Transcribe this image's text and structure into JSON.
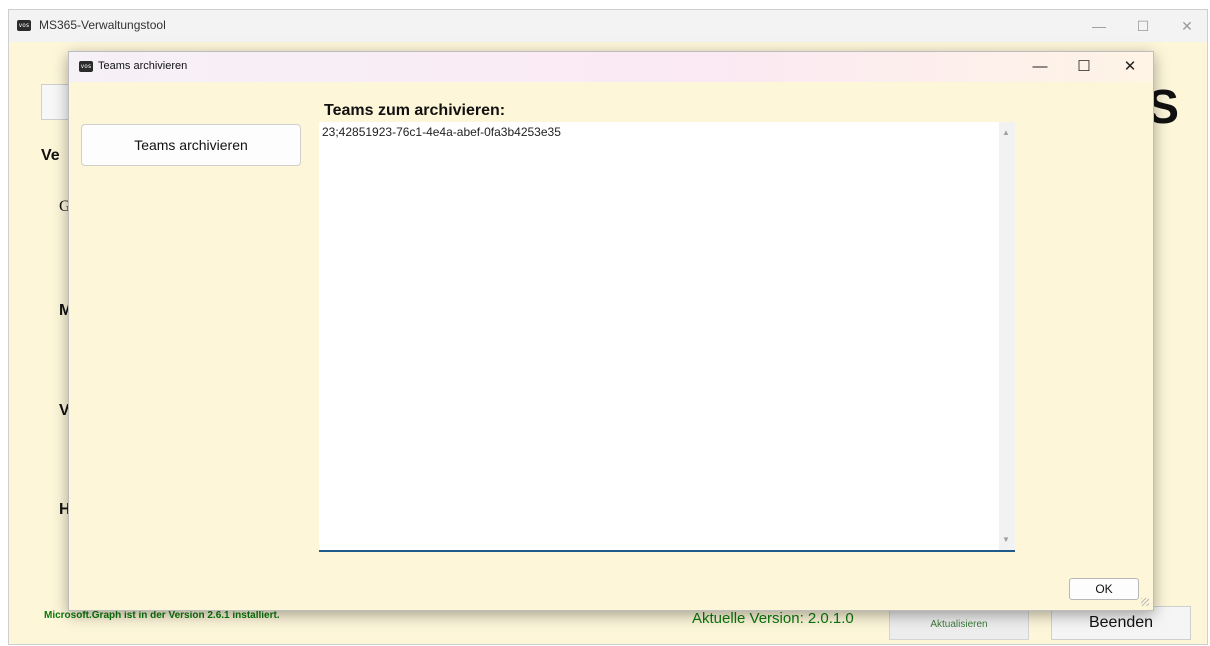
{
  "main_window": {
    "title": "MS365-Verwaltungstool",
    "icon": "vows-app-icon",
    "controls": {
      "minimize": "—",
      "maximize": "☐",
      "close": "✕"
    },
    "background_labels": {
      "section_header": "Ve",
      "item1": "G",
      "item2": "M",
      "item3": "V",
      "item4": "H",
      "right_fragment": "S"
    },
    "status_text": "Microsoft.Graph ist in der Version 2.6.1 installiert.",
    "version_text": "Aktuelle Version: 2.0.1.0",
    "update_button": "Aktualisieren",
    "quit_button": "Beenden"
  },
  "dialog": {
    "title": "Teams archivieren",
    "icon": "vows-app-icon",
    "controls": {
      "minimize": "—",
      "maximize": "☐",
      "close": "✕"
    },
    "archive_button": "Teams archivieren",
    "list_label": "Teams zum archivieren:",
    "textarea_value": "23;42851923-76c1-4e4a-abef-0fa3b4253e35",
    "ok_button": "OK"
  },
  "colors": {
    "background": "#fdf6d9",
    "status_green": "#0a7a0a",
    "accent_blue": "#1f5b8a"
  }
}
